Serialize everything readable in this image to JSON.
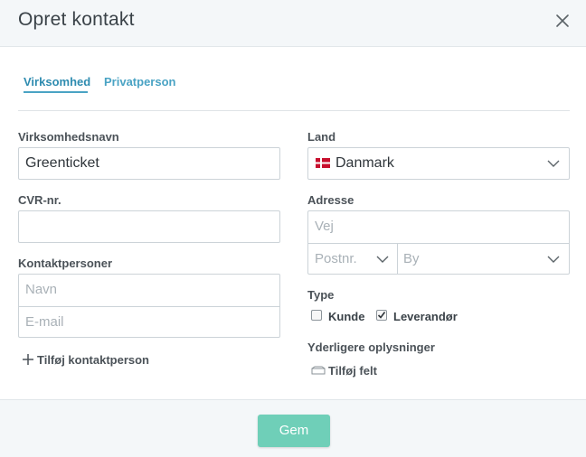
{
  "dialog": {
    "title": "Opret kontakt"
  },
  "tabs": [
    {
      "label": "Virksomhed",
      "active": true
    },
    {
      "label": "Privatperson",
      "active": false
    }
  ],
  "left": {
    "company_name": {
      "label": "Virksomhedsnavn",
      "value": "Greenticket"
    },
    "cvr": {
      "label": "CVR-nr.",
      "value": ""
    },
    "contacts": {
      "label": "Kontaktpersoner",
      "name_placeholder": "Navn",
      "email_placeholder": "E-mail",
      "add_label": "Tilføj kontaktperson"
    }
  },
  "right": {
    "country": {
      "label": "Land",
      "value": "Danmark",
      "flag": "denmark-flag-icon"
    },
    "address": {
      "label": "Adresse",
      "street_placeholder": "Vej",
      "postal_placeholder": "Postnr.",
      "city_placeholder": "By"
    },
    "type": {
      "label": "Type",
      "options": [
        {
          "label": "Kunde",
          "checked": false
        },
        {
          "label": "Leverandør",
          "checked": true
        }
      ]
    },
    "extra": {
      "label": "Yderligere oplysninger",
      "add_field_label": "Tilføj felt"
    }
  },
  "footer": {
    "save_label": "Gem"
  },
  "colors": {
    "accent": "#4aa3c4",
    "save_button": "#6fcfb8",
    "header_bg": "#f4f7f9"
  }
}
